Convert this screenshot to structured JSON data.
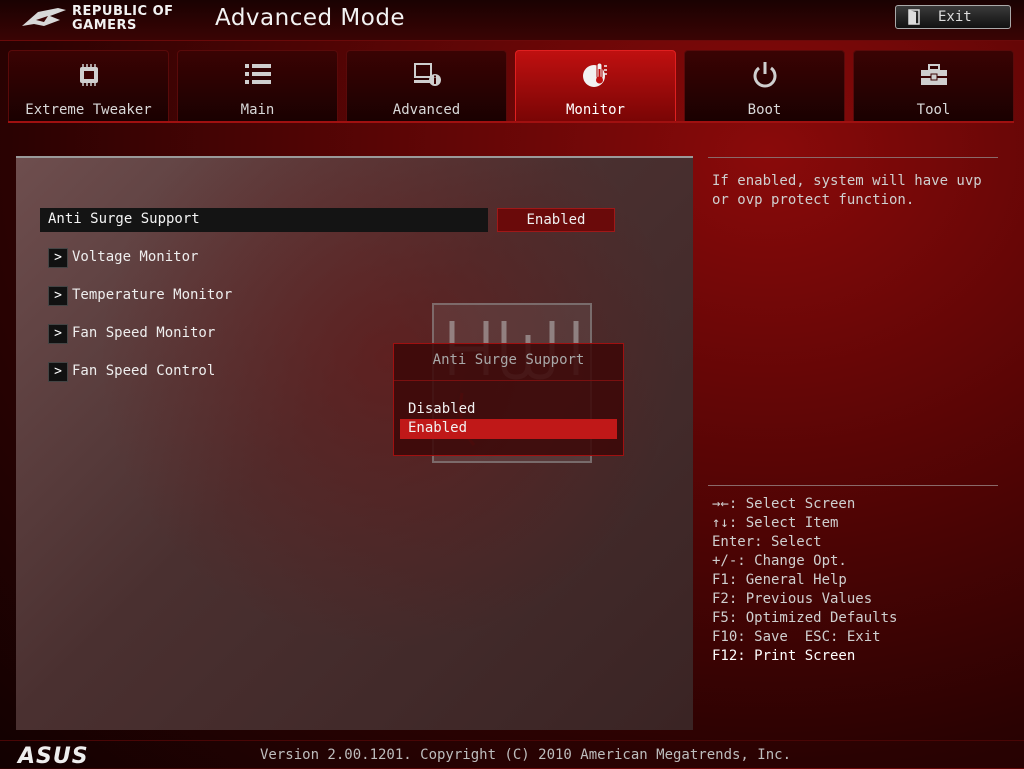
{
  "header": {
    "brand_line1": "REPUBLIC OF",
    "brand_line2": "GAMERS",
    "mode_title": "Advanced Mode",
    "exit_label": "Exit"
  },
  "tabs": [
    {
      "label": "Extreme Tweaker",
      "icon": "chip-icon",
      "active": false
    },
    {
      "label": "Main",
      "icon": "list-icon",
      "active": false
    },
    {
      "label": "Advanced",
      "icon": "advanced-info-icon",
      "active": false
    },
    {
      "label": "Monitor",
      "icon": "thermometer-icon",
      "active": true
    },
    {
      "label": "Boot",
      "icon": "power-icon",
      "active": false
    },
    {
      "label": "Tool",
      "icon": "toolbox-icon",
      "active": false
    }
  ],
  "main": {
    "selected_item": {
      "label": "Anti Surge Support",
      "value": "Enabled"
    },
    "submenus": [
      {
        "label": "Voltage Monitor"
      },
      {
        "label": "Temperature Monitor"
      },
      {
        "label": "Fan Speed Monitor"
      },
      {
        "label": "Fan Speed Control"
      }
    ]
  },
  "popup": {
    "title": "Anti Surge Support",
    "options": [
      "Disabled",
      "Enabled"
    ],
    "selected": "Enabled"
  },
  "help": {
    "description": "If enabled, system will have uvp or ovp protect function.",
    "keys": [
      "→←: Select Screen",
      "↑↓: Select Item",
      "Enter: Select",
      "+/-: Change Opt.",
      "F1: General Help",
      "F2: Previous Values",
      "F5: Optimized Defaults",
      "F10: Save  ESC: Exit",
      "F12: Print Screen"
    ]
  },
  "footer": {
    "brand": "ASUS",
    "version": "Version 2.00.1201. Copyright (C) 2010 American Megatrends, Inc."
  },
  "colors": {
    "accent": "#c01818",
    "tab_active": "#c01010",
    "background": "#2a0202"
  }
}
